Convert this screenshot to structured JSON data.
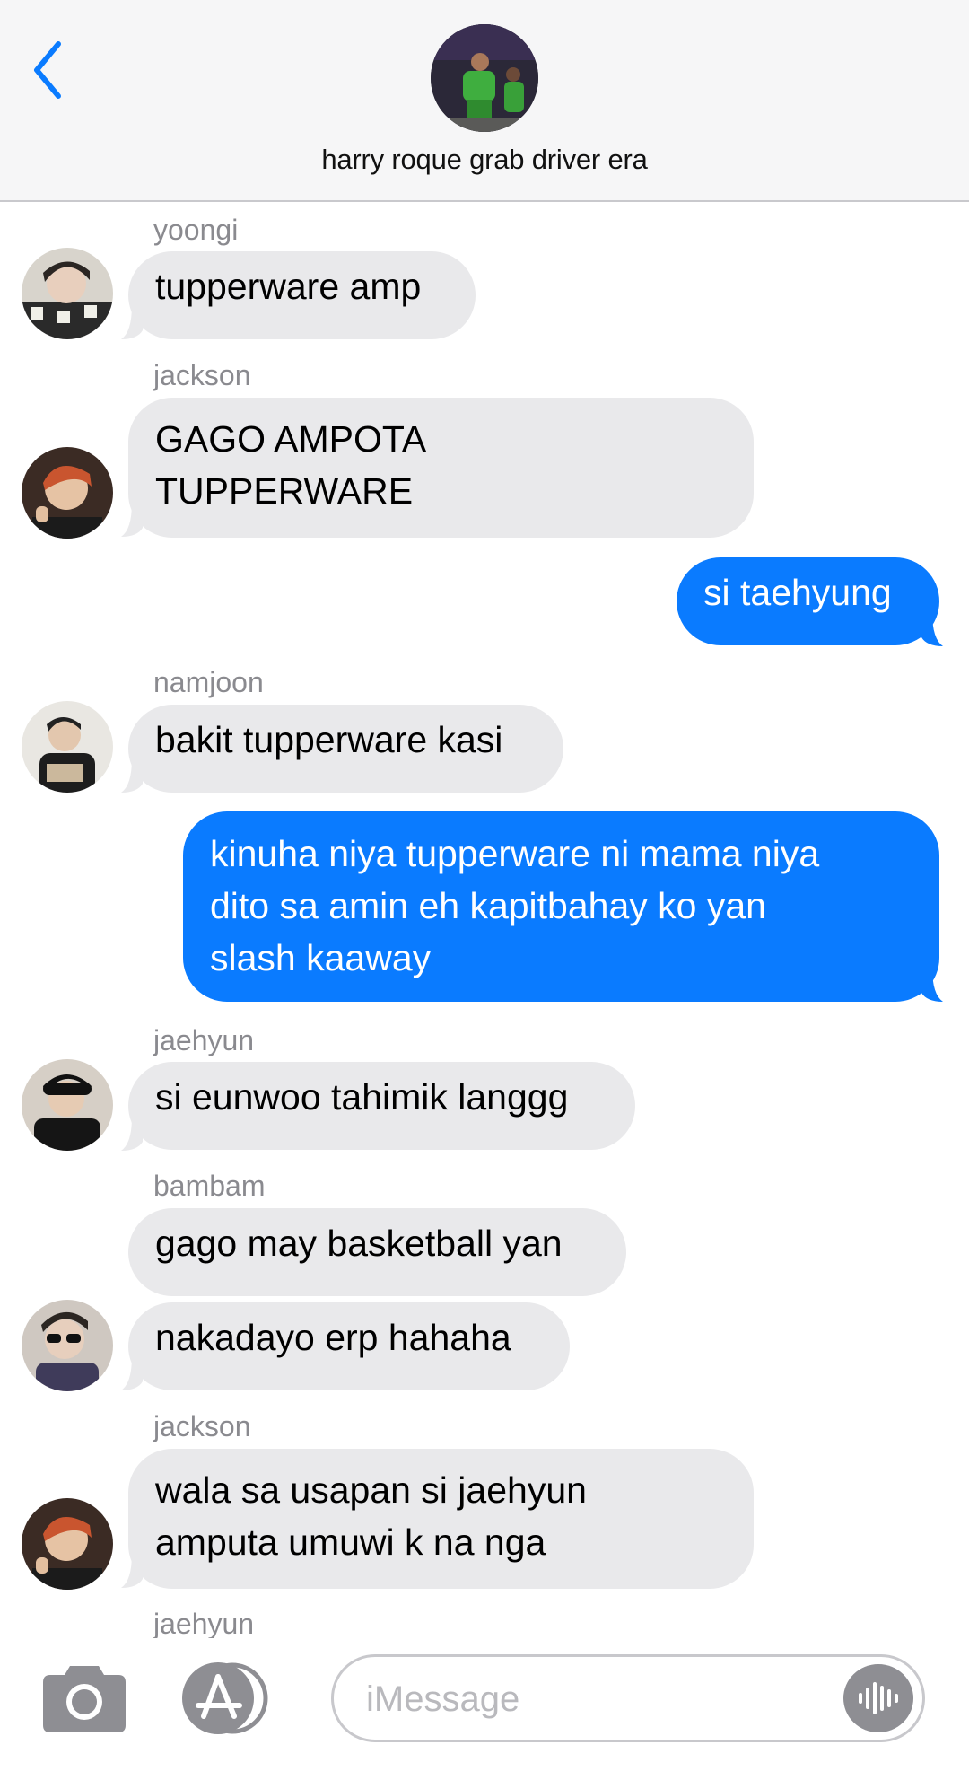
{
  "header": {
    "title": "harry roque grab driver era",
    "back_icon": "chevron-left-icon"
  },
  "colors": {
    "outgoing_bubble": "#0a7bff",
    "incoming_bubble": "#e9e9eb",
    "accent": "#0a7bff",
    "sender_name": "#8a8a8f"
  },
  "messages": [
    {
      "sender": "yoongi",
      "lines": [
        "tupperware amp"
      ]
    },
    {
      "sender": "jackson",
      "lines": [
        "GAGO AMPOTA",
        "TUPPERWARE"
      ]
    },
    {
      "sender": "me",
      "lines": [
        "si taehyung"
      ]
    },
    {
      "sender": "namjoon",
      "lines": [
        "bakit tupperware kasi"
      ]
    },
    {
      "sender": "me",
      "lines": [
        "kinuha niya tupperware ni mama niya",
        "dito sa amin eh kapitbahay ko yan",
        "slash kaaway"
      ]
    },
    {
      "sender": "jaehyun",
      "lines": [
        "si eunwoo tahimik langgg"
      ]
    },
    {
      "sender": "bambam",
      "lines": [
        "gago may basketball yan"
      ]
    },
    {
      "sender": "bambam",
      "lines": [
        "nakadayo erp hahaha"
      ]
    },
    {
      "sender": "jackson",
      "lines": [
        "wala sa usapan si jaehyun",
        "amputa umuwi k na nga"
      ]
    },
    {
      "sender": "jaehyun",
      "lines": []
    }
  ],
  "input": {
    "placeholder": "iMessage",
    "camera_icon": "camera-icon",
    "apps_icon": "app-store-icon",
    "audio_icon": "audio-waveform-icon"
  }
}
